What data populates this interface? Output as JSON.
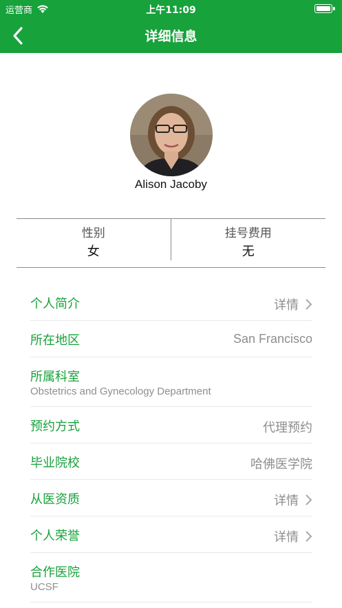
{
  "status_bar": {
    "carrier": "运营商",
    "time": "上午11:09",
    "battery_level": 1.0
  },
  "nav": {
    "title": "详细信息",
    "back_icon": "chevron-left-icon"
  },
  "profile": {
    "name": "Alison Jacoby"
  },
  "info": {
    "gender_label": "性别",
    "gender_value": "女",
    "fee_label": "挂号费用",
    "fee_value": "无"
  },
  "rows": {
    "intro": {
      "title": "个人简介",
      "value": "详情"
    },
    "region": {
      "title": "所在地区",
      "value": "San Francisco"
    },
    "department": {
      "title": "所属科室",
      "value": "Obstetrics and Gynecology Department"
    },
    "booking": {
      "title": "预约方式",
      "value": "代理预约"
    },
    "school": {
      "title": "毕业院校",
      "value": "哈佛医学院"
    },
    "qualification": {
      "title": "从医资质",
      "value": "详情"
    },
    "honors": {
      "title": "个人荣誉",
      "value": "详情"
    },
    "hospital": {
      "title": "合作医院",
      "value": "UCSF"
    }
  },
  "colors": {
    "brand_green": "#17a23b",
    "muted_text": "#8e8e8e"
  }
}
